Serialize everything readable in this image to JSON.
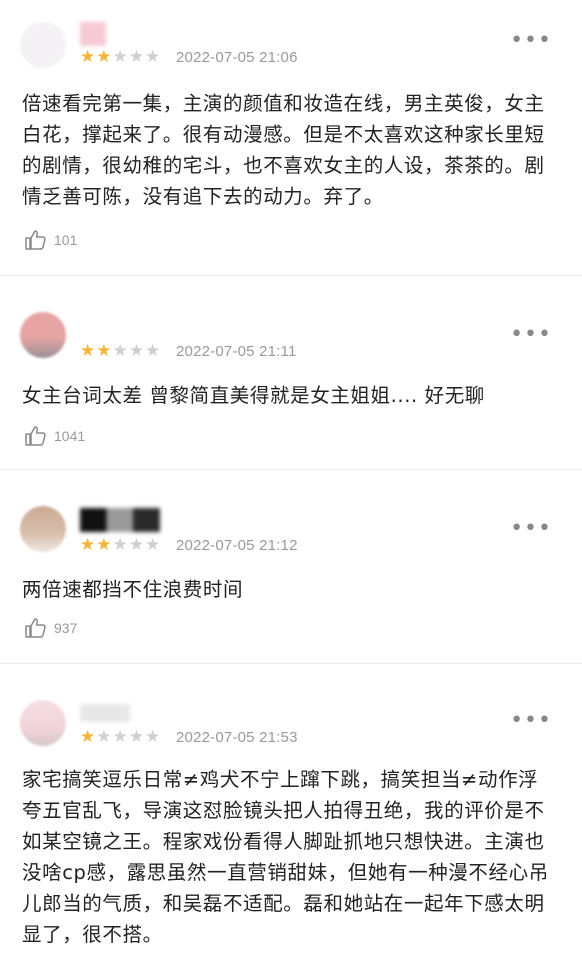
{
  "comments": [
    {
      "stars": 2,
      "date": "2022-07-05 21:06",
      "more": "•••",
      "text": "倍速看完第一集，主演的颜值和妆造在线，男主英俊，女主白花，撑起来了。很有动漫感。但是不太喜欢这种家长里短的剧情，很幼稚的宅斗，也不喜欢女主的人设，茶茶的。剧情乏善可陈，没有追下去的动力。弃了。",
      "likes": "101"
    },
    {
      "stars": 2,
      "date": "2022-07-05 21:11",
      "more": "•••",
      "text": "女主台词太差 曾黎简直美得就是女主姐姐.... 好无聊",
      "likes": "1041"
    },
    {
      "stars": 2,
      "date": "2022-07-05 21:12",
      "more": "•••",
      "text": "两倍速都挡不住浪费时间",
      "likes": "937"
    },
    {
      "stars": 1,
      "date": "2022-07-05 21:53",
      "more": "•••",
      "text": "家宅搞笑逗乐日常≠鸡犬不宁上蹿下跳，搞笑担当≠动作浮夸五官乱飞，导演这怼脸镜头把人拍得丑绝，我的评价是不如某空镜之王。程家戏份看得人脚趾抓地只想快进。主演也没啥cp感，露思虽然一直营销甜妹，但她有一种漫不经心吊儿郎当的气质，和吴磊不适配。磊和她站在一起年下感太明显了，很不搭。",
      "likes": ""
    }
  ],
  "colors": {
    "star_on": "#f5b53a",
    "star_off": "#cfcfcf",
    "date": "#9a9a9a",
    "divider": "#ececec"
  },
  "icons": {
    "like": "thumbs-up-icon",
    "more": "more-dots-icon",
    "star": "star-icon"
  }
}
